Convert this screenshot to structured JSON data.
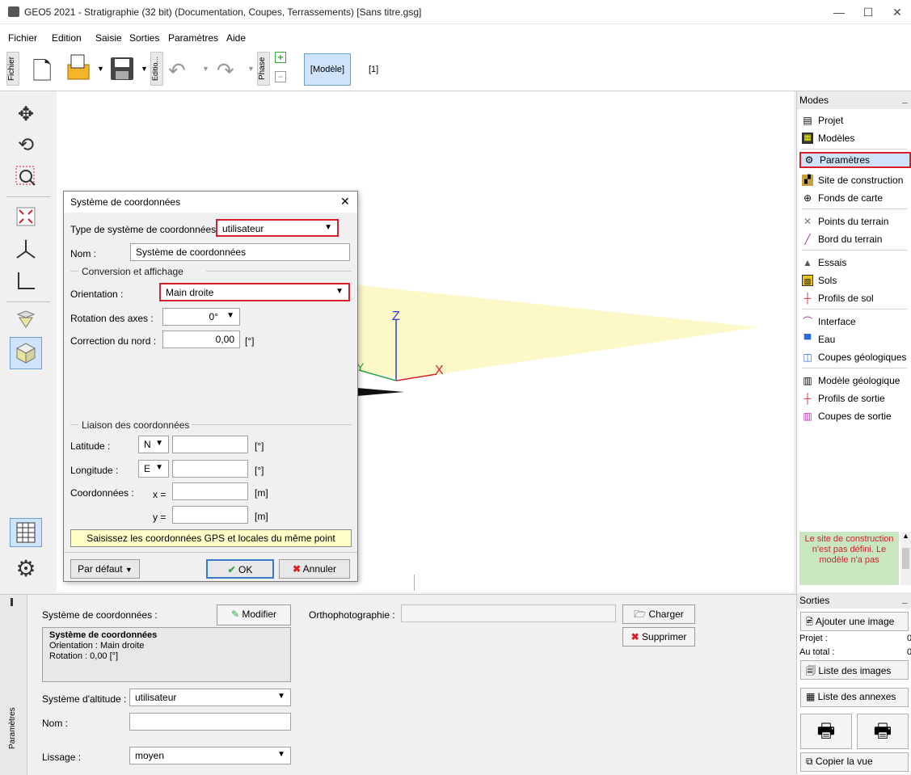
{
  "window": {
    "title": "GEO5 2021 - Stratigraphie (32 bit) (Documentation, Coupes, Terrassements) [Sans titre.gsg]",
    "minimize": "—",
    "maximize": "☐",
    "close": "✕"
  },
  "menu": [
    "Fichier",
    "Edition",
    "Saisie",
    "Sorties",
    "Paramètres",
    "Aide"
  ],
  "toolbar": {
    "fichier_tab": "Fichier",
    "edition_tab": "Editio...",
    "phase_tab": "Phase",
    "modele_button": "[Modèle]",
    "phase_number": "[1]"
  },
  "axes": {
    "x": "X",
    "y": "Y",
    "z": "Z"
  },
  "dialog": {
    "title": "Système de coordonnées",
    "close": "✕",
    "type_label": "Type de système de coordonnées :",
    "type_value": "utilisateur",
    "name_label": "Nom :",
    "name_value": "Système de coordonnées",
    "conversion_group": "Conversion et affichage",
    "orientation_label": "Orientation :",
    "orientation_value": "Main droite",
    "rotation_label": "Rotation des axes :",
    "rotation_value": "0°",
    "north_label": "Correction du nord :",
    "north_value": "0,00",
    "north_unit": "[°]",
    "liaison_group": "Liaison des coordonnées",
    "latitude_label": "Latitude :",
    "latitude_dir": "N",
    "latitude_value": "",
    "latitude_unit": "[°]",
    "longitude_label": "Longitude :",
    "longitude_dir": "E",
    "longitude_value": "",
    "longitude_unit": "[°]",
    "coords_label": "Coordonnées :",
    "x_label": "x =",
    "x_value": "",
    "x_unit": "[m]",
    "y_label": "y =",
    "y_value": "",
    "y_unit": "[m]",
    "note": "Saisissez les coordonnées GPS et locales du même point",
    "default_button": "Par défaut",
    "ok_button": "OK",
    "cancel_button": "Annuler"
  },
  "modes": {
    "header": "Modes",
    "collapse": "_",
    "items": [
      "Projet",
      "Modèles",
      "Paramètres",
      "Site de construction",
      "Fonds de carte",
      "Points du terrain",
      "Bord du terrain",
      "Essais",
      "Sols",
      "Profils de sol",
      "Interface",
      "Eau",
      "Coupes géologiques",
      "Modèle géologique",
      "Profils de sortie",
      "Coupes de sortie"
    ],
    "warning": "Le site de construction n'est pas défini. Le modèle n'a pas"
  },
  "sorties": {
    "header": "Sorties",
    "collapse": "_",
    "add_image": "Ajouter une image",
    "projet_label": "Projet :",
    "projet_value": "0",
    "total_label": "Au total :",
    "total_value": "0",
    "image_list": "Liste des images",
    "annex_list": "Liste des annexes",
    "copy_view": "Copier la vue"
  },
  "params": {
    "side_tab": "Paramètres",
    "coord_label": "Système de coordonnées :",
    "modify_button": "Modifier",
    "ortho_label": "Orthophotographie :",
    "ortho_value": "",
    "load_button": "Charger",
    "delete_button": "Supprimer",
    "summary_title": "Système de coordonnées",
    "summary_orientation": "Orientation : Main droite",
    "summary_rotation": "Rotation : 0,00 [°]",
    "altitude_label": "Système d'altitude :",
    "altitude_value": "utilisateur",
    "name_label": "Nom :",
    "name_value": "",
    "smoothing_label": "Lissage :",
    "smoothing_value": "moyen"
  },
  "colors": {
    "highlight_red": "#d8202c",
    "selected_blue": "#cfe4fa",
    "plane_yellow": "#fdf8c8",
    "warning_green": "#c8e6c0"
  }
}
